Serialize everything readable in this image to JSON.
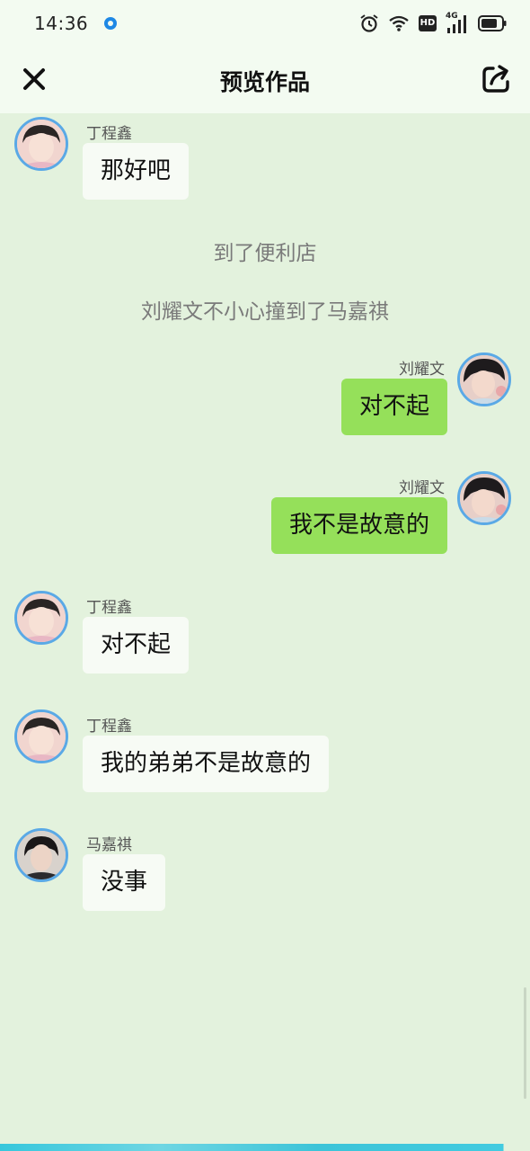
{
  "status_bar": {
    "time": "14:36",
    "hd_label": "HD",
    "network_label": "4G"
  },
  "header": {
    "title": "预览作品",
    "close_icon": "close-icon",
    "share_icon": "share-icon"
  },
  "colors": {
    "background": "#e3f2dd",
    "header_background": "#f3fbf1",
    "left_bubble": "#f7fbf5",
    "right_bubble": "#95e05a",
    "avatar_border": "#5aa9e6",
    "narration_text": "#7a7a7a"
  },
  "chat": {
    "messages": [
      {
        "speaker": "丁程鑫",
        "text": "那好吧",
        "side": "left"
      },
      {
        "text": "到了便利店",
        "type": "narration"
      },
      {
        "text": "刘耀文不小心撞到了马嘉祺",
        "type": "narration"
      },
      {
        "speaker": "刘耀文",
        "text": "对不起",
        "side": "right"
      },
      {
        "speaker": "刘耀文",
        "text": "我不是故意的",
        "side": "right"
      },
      {
        "speaker": "丁程鑫",
        "text": "对不起",
        "side": "left"
      },
      {
        "speaker": "丁程鑫",
        "text": "我的弟弟不是故意的",
        "side": "left"
      },
      {
        "speaker": "马嘉祺",
        "text": "没事",
        "side": "left"
      }
    ]
  }
}
